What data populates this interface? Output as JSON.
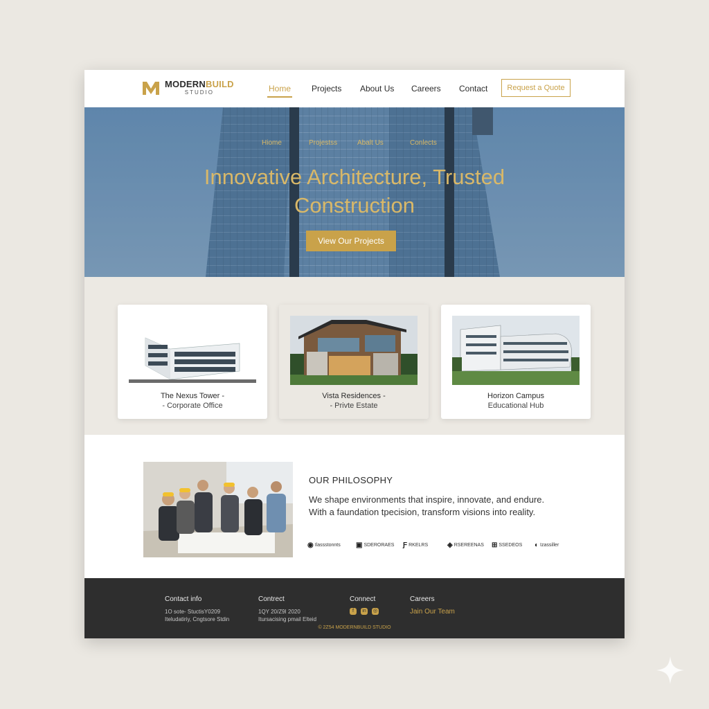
{
  "brand": {
    "name_part1": "MODERN",
    "name_part2": "BUILD",
    "subtitle": "STUDIO",
    "accent_color": "#c9a24a"
  },
  "nav": {
    "items": [
      "Home",
      "Projects",
      "About Us",
      "Careers",
      "Contact"
    ],
    "active": "Home",
    "quote_button": "Request a Quote"
  },
  "hero": {
    "overlay_nav": [
      "Hiome",
      "Projestss",
      "Abalt Us",
      "Conlects"
    ],
    "title_line1": "Innovative Architecture, Trusted",
    "title_line2": "Construction",
    "cta": "View Our Projects"
  },
  "projects": [
    {
      "title": "The Nexus Tower -",
      "subtitle": "- Corporate Office"
    },
    {
      "title": "Vista Residences -",
      "subtitle": "- Privte Estate"
    },
    {
      "title": "Horizon Campus",
      "subtitle": "Educational Hub"
    }
  ],
  "philosophy": {
    "heading": "OUR PHILOSOPHY",
    "line1": "We shape environments that inspire, innovate, and endure.",
    "line2": "With a faundation tpecision, transform visions into reality.",
    "partners": [
      "Ilassstonnts",
      "SDERORAES",
      "RKELRS",
      "RSEREENAS",
      "SSEDEOS",
      "Izassiller"
    ]
  },
  "footer": {
    "contact_info": {
      "heading": "Contact info",
      "line1": "1O sote- StuctisY0209",
      "line2": "Iteludatiriy, Cngtsore Stdin"
    },
    "contract": {
      "heading": "Contrect",
      "line1": "1QY 20/Z9I 2020",
      "line2": "Itursacising pmail Elteid"
    },
    "connect": {
      "heading": "Connect"
    },
    "careers": {
      "heading": "Careers",
      "link": "Jain Our Team"
    },
    "copyright": "© 2Z54 MODERNBUILD STUDIO"
  }
}
